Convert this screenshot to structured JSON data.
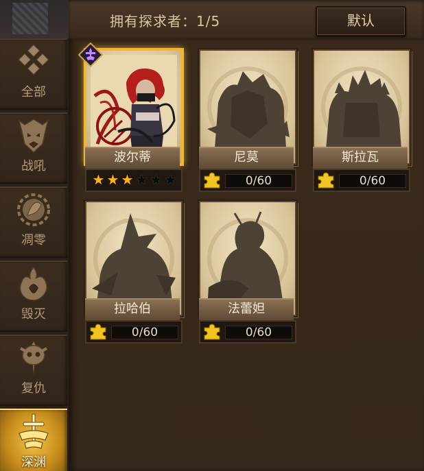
{
  "header": {
    "owned_label": "拥有探求者：1/5",
    "default_button": "默认"
  },
  "sidebar": {
    "items": [
      {
        "label": "全部",
        "icon": "all-diamond-icon"
      },
      {
        "label": "战吼",
        "icon": "warcry-mask-icon"
      },
      {
        "label": "凋零",
        "icon": "wither-leaf-icon"
      },
      {
        "label": "毁灭",
        "icon": "destruction-flame-icon"
      },
      {
        "label": "复仇",
        "icon": "vengeance-skull-icon"
      },
      {
        "label": "深渊",
        "icon": "abyss-sword-icon",
        "active": true
      }
    ]
  },
  "cards": [
    {
      "name": "波尔蒂",
      "owned": true,
      "stars_filled": 3,
      "stars_total": 6
    },
    {
      "name": "尼莫",
      "owned": false,
      "progress": "0/60"
    },
    {
      "name": "斯拉瓦",
      "owned": false,
      "progress": "0/60"
    },
    {
      "name": "拉哈伯",
      "owned": false,
      "progress": "0/60"
    },
    {
      "name": "法蕾妲",
      "owned": false,
      "progress": "0/60"
    }
  ],
  "colors": {
    "accent_gold": "#f4b52f",
    "star_on": "#ffb11e",
    "text_light": "#f4ead4"
  }
}
